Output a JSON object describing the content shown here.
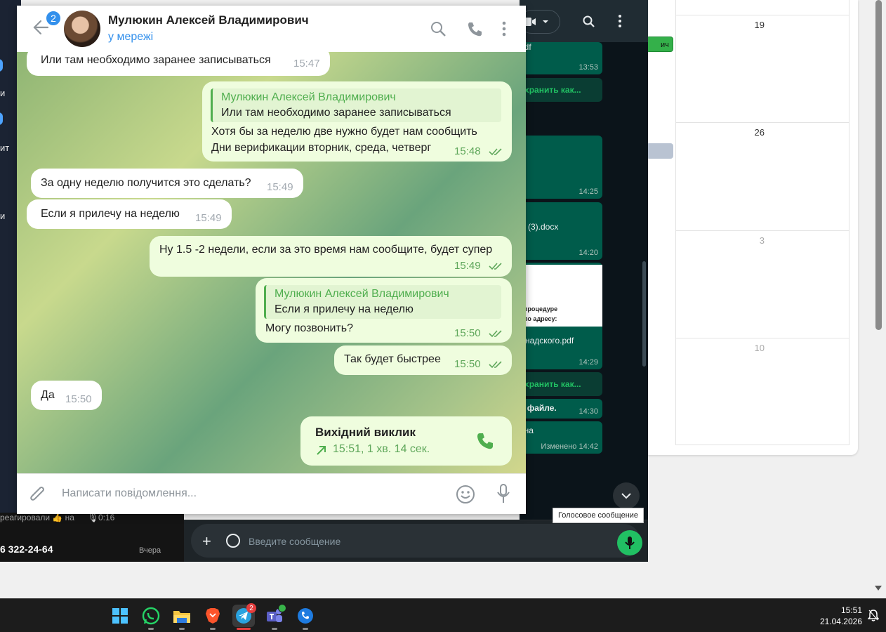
{
  "telegram": {
    "header": {
      "unread_badge": "2",
      "contact_name": "Мулюкин Алексей Владимирович",
      "status": "у мережі"
    },
    "messages": [
      {
        "dir": "in",
        "text": "Или там необходимо заранее записываться",
        "time": "15:47"
      },
      {
        "dir": "out",
        "reply_name": "Мулюкин Алексей Владимирович",
        "reply_text": "Или там необходимо заранее записываться",
        "lines": [
          "Хотя бы за неделю две нужно будет нам сообщить",
          "Дни верификации вторник, среда, четверг"
        ],
        "time": "15:48"
      },
      {
        "dir": "in",
        "text": "За одну неделю получится это сделать?",
        "time": "15:49"
      },
      {
        "dir": "in",
        "text": "Если я прилечу на неделю",
        "time": "15:49"
      },
      {
        "dir": "out",
        "text": "Ну 1.5 -2 недели, если за это время нам сообщите, будет супер",
        "time": "15:49"
      },
      {
        "dir": "out",
        "reply_name": "Мулюкин Алексей Владимирович",
        "reply_text": "Если я прилечу на неделю",
        "text": "Могу позвонить?",
        "time": "15:50"
      },
      {
        "dir": "out",
        "text": "Так будет быстрее",
        "time": "15:50"
      },
      {
        "dir": "in",
        "text": "Да",
        "time": "15:50"
      },
      {
        "dir": "out",
        "call_title": "Вихідний виклик",
        "call_detail": "15:51, 1 хв. 14 сек."
      }
    ],
    "input_placeholder": "Написати повідомлення..."
  },
  "whatsapp": {
    "messages": [
      {
        "text": "pdf",
        "time": "13:53"
      },
      {
        "text": "охранить как...",
        "time": ""
      },
      {
        "text": "",
        "time": "14:25"
      },
      {
        "text": "(3).docx",
        "time": "14:20"
      },
      {
        "text": "процедуре",
        "time": ""
      },
      {
        "text": "по адресу:",
        "time": ""
      },
      {
        "text": "надского.pdf",
        "time": "14:29"
      },
      {
        "text": "охранить как...",
        "time": ""
      },
      {
        "text": "в файле.",
        "time": "14:30"
      },
      {
        "text": "ана",
        "time": "Изменено 14:42"
      }
    ],
    "input_placeholder": "Введите сообщение",
    "tooltip": "Голосовое сообщение"
  },
  "left_app": {
    "items": [
      "и",
      "ит",
      "и"
    ],
    "bottom_text": "реагировали 👍 на",
    "bottom_duration": "0:16",
    "phone": "6 322-24-64",
    "phone_time": "Вчера"
  },
  "calendar": {
    "event_label": "ич",
    "days": [
      "19",
      "26",
      "3",
      "10"
    ]
  },
  "taskbar": {
    "time": "15:51",
    "date": "21.04.2026",
    "telegram_badge": "2"
  },
  "colors": {
    "telegram_accent": "#3390ec",
    "bubble_out": "#effdde",
    "whatsapp_green": "#21c063"
  }
}
